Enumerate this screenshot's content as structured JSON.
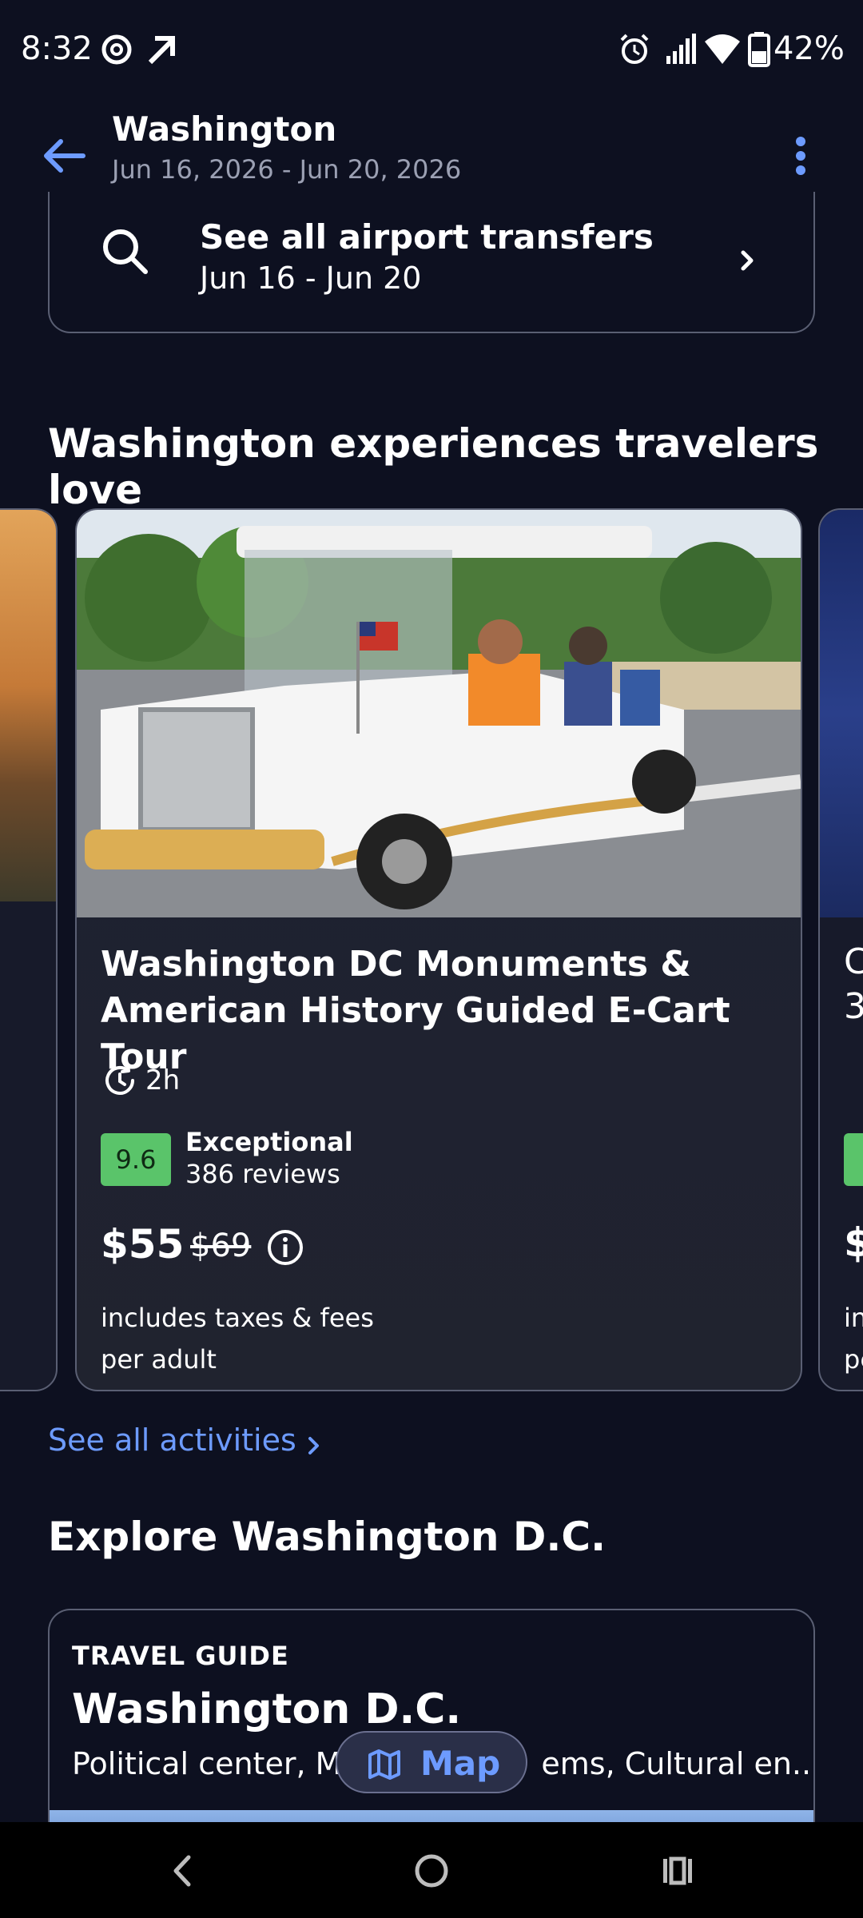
{
  "status_bar": {
    "time": "8:32",
    "battery": "42%",
    "icons": [
      "threads-icon",
      "arrow-up-right-icon",
      "alarm-icon",
      "signal-icon",
      "wifi-icon",
      "battery-icon"
    ]
  },
  "app_bar": {
    "title": "Washington",
    "subtitle": "Jun 16, 2026 - Jun 20, 2026",
    "back_icon": "back-arrow-icon",
    "menu_icon": "more-vertical-icon"
  },
  "transfers": {
    "title": "See all airport transfers",
    "dates": "Jun 16 - Jun 20"
  },
  "experiences": {
    "section_title": "Washington experiences travelers love",
    "main_card": {
      "title": "Washington DC Monuments & American History Guided E-Cart Tour",
      "duration": "2h",
      "rating_score": "9.6",
      "rating_label": "Exceptional",
      "reviews": "386 reviews",
      "price": "$55",
      "original_price": "$69",
      "price_note": "includes taxes & fees",
      "price_unit": "per adult"
    },
    "right_card_preview": {
      "title_line1": "C",
      "title_line2": "3",
      "price": "$",
      "note1": "in",
      "note2": "pe"
    },
    "see_all": "See all activities"
  },
  "explore": {
    "section_title": "Explore Washington D.C.",
    "eyebrow": "TRAVEL GUIDE",
    "title": "Washington D.C.",
    "description_start": "Political center, M",
    "description_end": "ems, Cultural en..."
  },
  "map_button": {
    "label": "Map"
  },
  "colors": {
    "background": "#0d1020",
    "accent": "#6d9bff",
    "rating_green": "#5ac46a",
    "card_border": "#5a5f73"
  }
}
